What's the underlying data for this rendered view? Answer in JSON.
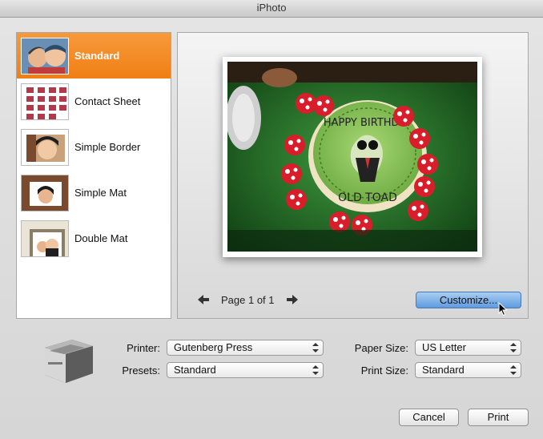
{
  "window": {
    "title": "iPhoto"
  },
  "themes": [
    {
      "label": "Standard",
      "selected": true
    },
    {
      "label": "Contact Sheet",
      "selected": false
    },
    {
      "label": "Simple Border",
      "selected": false
    },
    {
      "label": "Simple Mat",
      "selected": false
    },
    {
      "label": "Double Mat",
      "selected": false
    }
  ],
  "preview": {
    "page_indicator": "Page 1 of 1",
    "customize_label": "Customize...",
    "photo_caption": "HAPPY BIRTHDAY OLD TOAD"
  },
  "settings": {
    "printer_label": "Printer:",
    "printer_value": "Gutenberg Press",
    "presets_label": "Presets:",
    "presets_value": "Standard",
    "paper_size_label": "Paper Size:",
    "paper_size_value": "US Letter",
    "print_size_label": "Print Size:",
    "print_size_value": "Standard"
  },
  "buttons": {
    "cancel": "Cancel",
    "print": "Print"
  },
  "colors": {
    "selection": "#f28a22",
    "customize": "#7fb1ea"
  }
}
